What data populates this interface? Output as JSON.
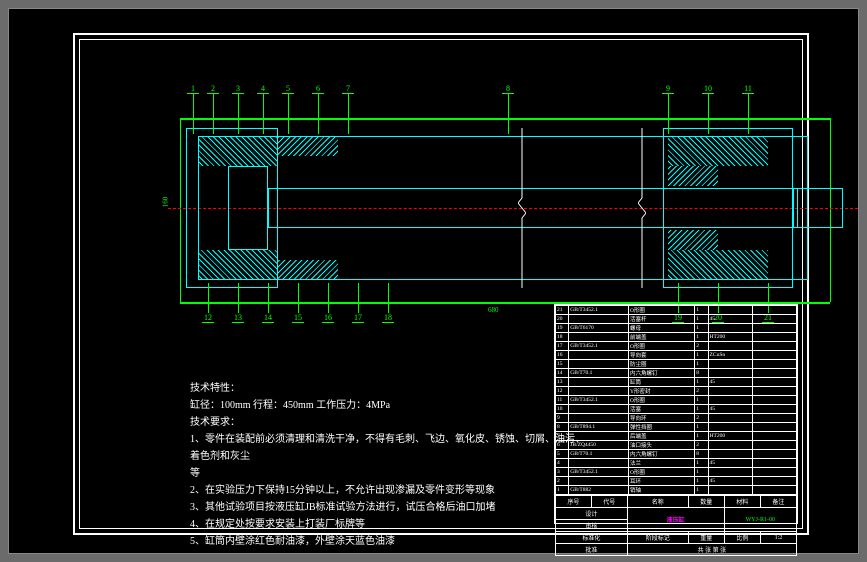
{
  "tech_params": {
    "title": "技术特性：",
    "line1": "缸径：100mm  行程：450mm  工作压力：4MPa"
  },
  "tech_req": {
    "title": "技术要求：",
    "item1": "1、零件在装配前必须清理和清洗干净，不得有毛刺、飞边、氧化皮、锈蚀、切屑、油污、着色剂和灰尘",
    "item1b": "等",
    "item2": "2、在实验压力下保持15分钟以上，不允许出现渗漏及零件变形等现象",
    "item3": "3、其他试验项目按液压缸JB标准试验方法进行，试压合格后油口加堵",
    "item4": "4、在规定处按要求安装上打装厂标牌等",
    "item5": "5、缸筒内壁涂红色耐油漆，外壁涂天蓝色油漆"
  },
  "leaders_top": [
    "1",
    "2",
    "3",
    "4",
    "5",
    "6",
    "7",
    "8",
    "9",
    "10",
    "11"
  ],
  "leaders_bot": [
    "12",
    "13",
    "14",
    "15",
    "16",
    "17",
    "18",
    "19",
    "20",
    "21"
  ],
  "bom_rows": [
    {
      "no": "21",
      "code": "GB/T3452.1",
      "name": "O形圈",
      "qty": "1",
      "mat": "",
      "note": ""
    },
    {
      "no": "20",
      "code": "",
      "name": "活塞杆",
      "qty": "1",
      "mat": "45",
      "note": ""
    },
    {
      "no": "19",
      "code": "GB/T6170",
      "name": "螺母",
      "qty": "1",
      "mat": "",
      "note": ""
    },
    {
      "no": "18",
      "code": "",
      "name": "前端盖",
      "qty": "1",
      "mat": "HT200",
      "note": ""
    },
    {
      "no": "17",
      "code": "GB/T3452.1",
      "name": "O形圈",
      "qty": "2",
      "mat": "",
      "note": ""
    },
    {
      "no": "16",
      "code": "",
      "name": "导向套",
      "qty": "1",
      "mat": "ZCuSn",
      "note": ""
    },
    {
      "no": "15",
      "code": "",
      "name": "防尘圈",
      "qty": "1",
      "mat": "",
      "note": ""
    },
    {
      "no": "14",
      "code": "GB/T70.1",
      "name": "内六角螺钉",
      "qty": "8",
      "mat": "",
      "note": ""
    },
    {
      "no": "13",
      "code": "",
      "name": "缸筒",
      "qty": "1",
      "mat": "45",
      "note": ""
    },
    {
      "no": "12",
      "code": "",
      "name": "Y形密封",
      "qty": "2",
      "mat": "",
      "note": ""
    },
    {
      "no": "11",
      "code": "GB/T3452.1",
      "name": "O形圈",
      "qty": "1",
      "mat": "",
      "note": ""
    },
    {
      "no": "10",
      "code": "",
      "name": "活塞",
      "qty": "1",
      "mat": "45",
      "note": ""
    },
    {
      "no": "9",
      "code": "",
      "name": "导向环",
      "qty": "2",
      "mat": "",
      "note": ""
    },
    {
      "no": "8",
      "code": "GB/T894.1",
      "name": "弹性挡圈",
      "qty": "1",
      "mat": "",
      "note": ""
    },
    {
      "no": "7",
      "code": "",
      "name": "后端盖",
      "qty": "1",
      "mat": "HT200",
      "note": ""
    },
    {
      "no": "6",
      "code": "JB/ZQ4450",
      "name": "油口接头",
      "qty": "2",
      "mat": "",
      "note": ""
    },
    {
      "no": "5",
      "code": "GB/T70.1",
      "name": "内六角螺钉",
      "qty": "8",
      "mat": "",
      "note": ""
    },
    {
      "no": "4",
      "code": "",
      "name": "法兰",
      "qty": "1",
      "mat": "45",
      "note": ""
    },
    {
      "no": "3",
      "code": "GB/T3452.1",
      "name": "O形圈",
      "qty": "1",
      "mat": "",
      "note": ""
    },
    {
      "no": "2",
      "code": "",
      "name": "耳环",
      "qty": "1",
      "mat": "45",
      "note": ""
    },
    {
      "no": "1",
      "code": "GB/T882",
      "name": "销轴",
      "qty": "1",
      "mat": "",
      "note": ""
    }
  ],
  "bom_header": {
    "no": "序号",
    "code": "代号",
    "name": "名称",
    "qty": "数量",
    "mat": "材料",
    "note": "备注"
  },
  "title_block": {
    "name_label": "液压缸",
    "dwg_no": "WYJ-R1-00",
    "scale_label": "比例",
    "scale": "1:2",
    "sheet_label": "共 张 第 张",
    "design": "设计",
    "check": "审核",
    "std": "标准化",
    "appr": "批准",
    "stage": "阶段标记",
    "weight": "重量",
    "qty": "数量"
  },
  "dims": {
    "overall": "680",
    "height": "160"
  }
}
